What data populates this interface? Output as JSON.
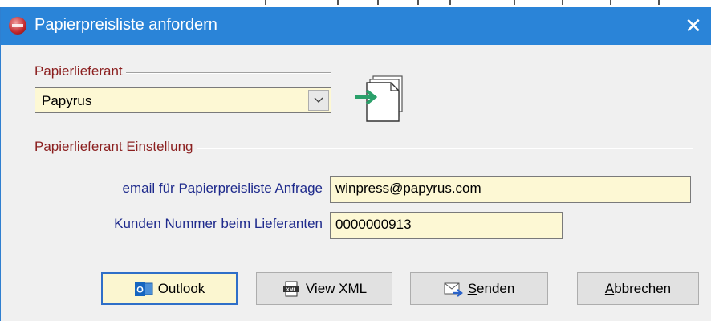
{
  "window": {
    "title": "Papierpreisliste anfordern",
    "close_glyph": "✕"
  },
  "supplier_group": {
    "label": "Papierlieferant",
    "selected": "Papyrus"
  },
  "settings_group": {
    "label": "Papierlieferant Einstellung",
    "email_label": "email für Papierpreisliste Anfrage",
    "email_value": "winpress@papyrus.com",
    "customer_label": "Kunden Nummer beim Lieferanten",
    "customer_value": "0000000913"
  },
  "buttons": {
    "outlook": "Outlook",
    "view_xml": "View XML",
    "send_prefix": "S",
    "send_rest": "enden",
    "cancel_prefix": "A",
    "cancel_rest": "bbrechen"
  },
  "icons": {
    "app": "app-logo-icon",
    "dropdown": "chevron-down-icon",
    "import": "document-import-icon",
    "outlook": "outlook-icon",
    "xml": "xml-file-icon",
    "send": "envelope-send-icon"
  },
  "colors": {
    "titlebar": "#2a84d8",
    "group_label": "#8b1f1f",
    "field_label": "#1e2a8c",
    "field_bg": "#fdf8d4",
    "default_button_border": "#2f6fc8"
  }
}
